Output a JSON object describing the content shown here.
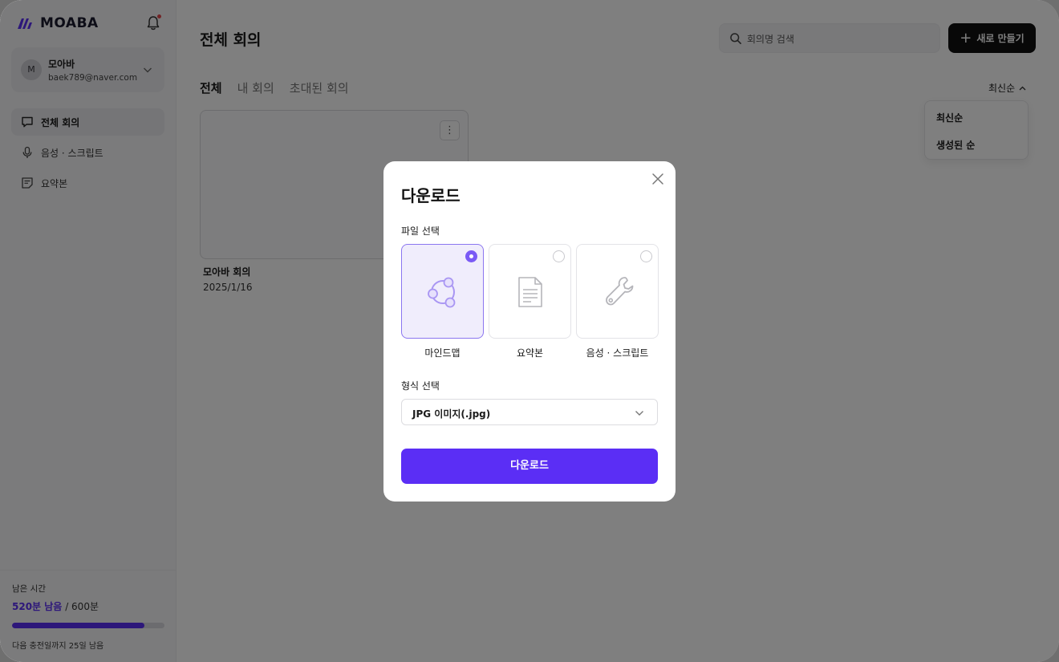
{
  "brand": {
    "name": "MOABA",
    "accent": "#5b2ef5"
  },
  "account": {
    "initial": "M",
    "name": "모아바",
    "email": "baek789@naver.com"
  },
  "sidebar": {
    "items": [
      {
        "label": "전체 회의",
        "icon": "chat-bubble-icon",
        "active": true
      },
      {
        "label": "음성 · 스크립트",
        "icon": "microphone-icon",
        "active": false
      },
      {
        "label": "요약본",
        "icon": "note-icon",
        "active": false
      }
    ]
  },
  "usage": {
    "title": "남은 시간",
    "remaining": "520분 남음",
    "total": "/ 600분",
    "progress": 0.8667,
    "footer": "다음 충전일까지 25일 남음"
  },
  "header": {
    "title": "전체 회의",
    "search_placeholder": "회의명 검색",
    "new_button": "새로 만들기"
  },
  "tabs": [
    {
      "label": "전체",
      "active": true
    },
    {
      "label": "내 회의",
      "active": false
    },
    {
      "label": "초대된 회의",
      "active": false
    }
  ],
  "sort": {
    "current": "최신순",
    "options": [
      "최신순",
      "생성된 순"
    ]
  },
  "meetings": [
    {
      "title": "모아바 회의",
      "date": "2025/1/16"
    }
  ],
  "modal": {
    "title": "다운로드",
    "file_label": "파일 선택",
    "file_options": [
      {
        "label": "마인드맵",
        "icon": "mindmap-icon",
        "selected": true
      },
      {
        "label": "요약본",
        "icon": "document-icon",
        "selected": false
      },
      {
        "label": "음성 · 스크립트",
        "icon": "wrench-icon",
        "selected": false
      }
    ],
    "format_label": "형식 선택",
    "format_value": "JPG 이미지(.jpg)",
    "download_button": "다운로드"
  }
}
